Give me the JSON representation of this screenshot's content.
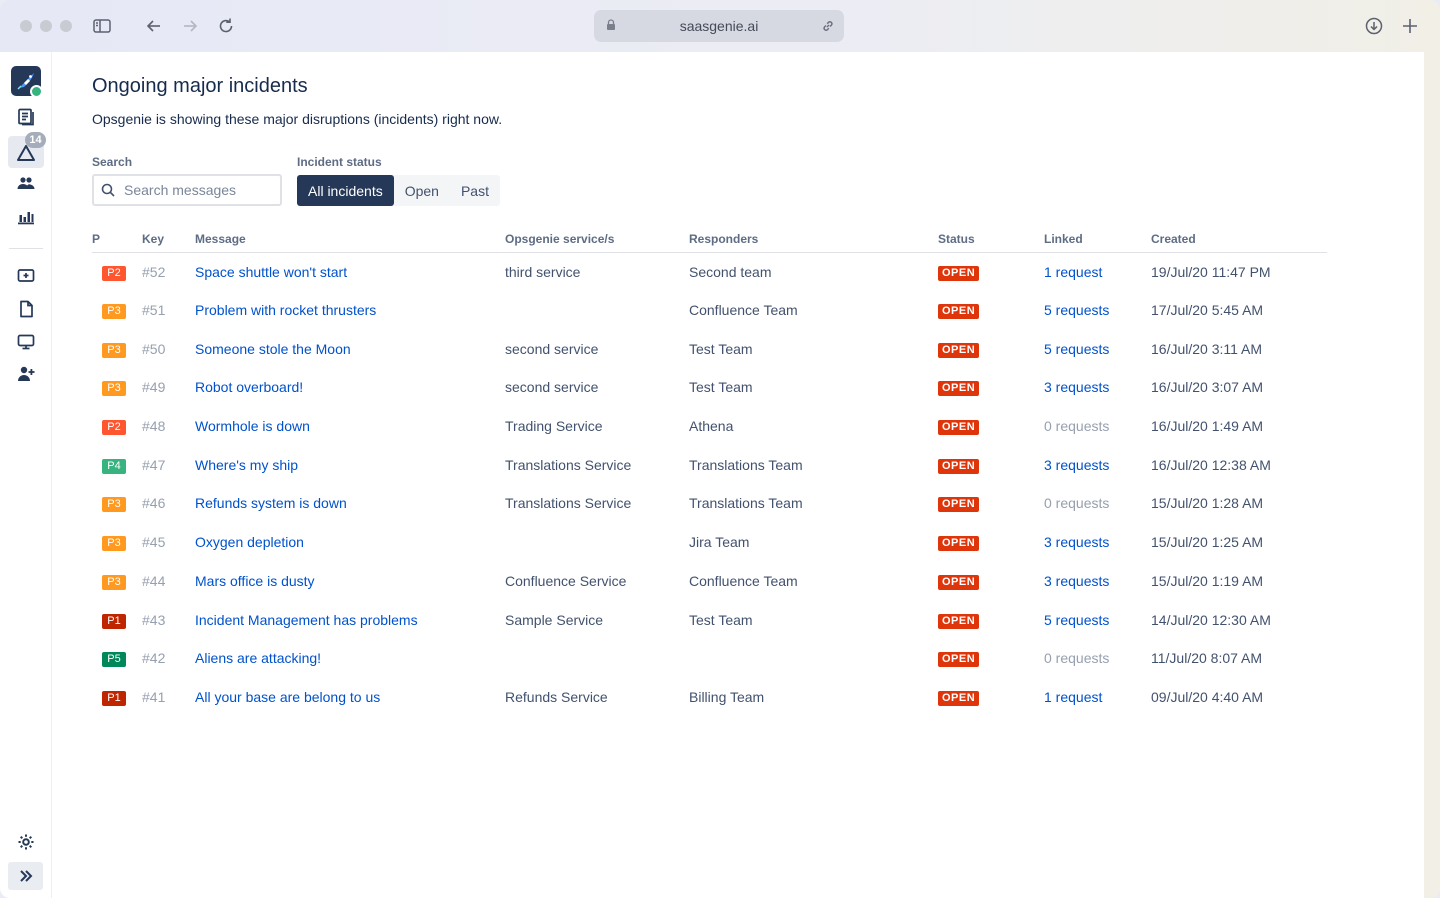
{
  "browser": {
    "url": "saasgenie.ai"
  },
  "sidebar": {
    "alerts_count": "14"
  },
  "page": {
    "title": "Ongoing major incidents",
    "subtitle": "Opsgenie is showing these major disruptions (incidents) right now."
  },
  "search": {
    "label": "Search",
    "placeholder": "Search messages",
    "value": ""
  },
  "status_filter": {
    "label": "Incident status",
    "options": [
      "All incidents",
      "Open",
      "Past"
    ],
    "selected": "All incidents"
  },
  "table": {
    "columns": [
      "P",
      "Key",
      "Message",
      "Opsgenie service/s",
      "Responders",
      "Status",
      "Linked",
      "Created"
    ],
    "rows": [
      {
        "p": "P2",
        "p_color": "#ff5630",
        "key": "#52",
        "message": "Space shuttle won't start",
        "service": "third service",
        "responders": "Second team",
        "status": "OPEN",
        "linked": "1 request",
        "linked_count": 1,
        "created": "19/Jul/20 11:47 PM"
      },
      {
        "p": "P3",
        "p_color": "#ff991f",
        "key": "#51",
        "message": "Problem with rocket thrusters",
        "service": "",
        "responders": "Confluence Team",
        "status": "OPEN",
        "linked": "5 requests",
        "linked_count": 5,
        "created": "17/Jul/20 5:45 AM"
      },
      {
        "p": "P3",
        "p_color": "#ff991f",
        "key": "#50",
        "message": "Someone stole the Moon",
        "service": "second service",
        "responders": "Test Team",
        "status": "OPEN",
        "linked": "5 requests",
        "linked_count": 5,
        "created": "16/Jul/20 3:11 AM"
      },
      {
        "p": "P3",
        "p_color": "#ff991f",
        "key": "#49",
        "message": "Robot overboard!",
        "service": "second service",
        "responders": "Test Team",
        "status": "OPEN",
        "linked": "3 requests",
        "linked_count": 3,
        "created": "16/Jul/20 3:07 AM"
      },
      {
        "p": "P2",
        "p_color": "#ff5630",
        "key": "#48",
        "message": "Wormhole is down",
        "service": "Trading Service",
        "responders": "Athena",
        "status": "OPEN",
        "linked": "0 requests",
        "linked_count": 0,
        "created": "16/Jul/20 1:49 AM"
      },
      {
        "p": "P4",
        "p_color": "#36b37e",
        "key": "#47",
        "message": "Where's my ship",
        "service": "Translations Service",
        "responders": "Translations Team",
        "status": "OPEN",
        "linked": "3 requests",
        "linked_count": 3,
        "created": "16/Jul/20 12:38 AM"
      },
      {
        "p": "P3",
        "p_color": "#ff991f",
        "key": "#46",
        "message": "Refunds system is down",
        "service": "Translations Service",
        "responders": "Translations Team",
        "status": "OPEN",
        "linked": "0 requests",
        "linked_count": 0,
        "created": "15/Jul/20 1:28 AM"
      },
      {
        "p": "P3",
        "p_color": "#ff991f",
        "key": "#45",
        "message": "Oxygen depletion",
        "service": "",
        "responders": "Jira Team",
        "status": "OPEN",
        "linked": "3 requests",
        "linked_count": 3,
        "created": "15/Jul/20 1:25 AM"
      },
      {
        "p": "P3",
        "p_color": "#ff991f",
        "key": "#44",
        "message": "Mars office is dusty",
        "service": "Confluence Service",
        "responders": "Confluence Team",
        "status": "OPEN",
        "linked": "3 requests",
        "linked_count": 3,
        "created": "15/Jul/20 1:19 AM"
      },
      {
        "p": "P1",
        "p_color": "#bf2600",
        "key": "#43",
        "message": "Incident Management has problems",
        "service": "Sample Service",
        "responders": "Test Team",
        "status": "OPEN",
        "linked": "5 requests",
        "linked_count": 5,
        "created": "14/Jul/20 12:30 AM"
      },
      {
        "p": "P5",
        "p_color": "#00875a",
        "key": "#42",
        "message": "Aliens are attacking!",
        "service": "",
        "responders": "",
        "status": "OPEN",
        "linked": "0 requests",
        "linked_count": 0,
        "created": "11/Jul/20 8:07 AM"
      },
      {
        "p": "P1",
        "p_color": "#bf2600",
        "key": "#41",
        "message": "All your base are belong to us",
        "service": "Refunds Service",
        "responders": "Billing Team",
        "status": "OPEN",
        "linked": "1 request",
        "linked_count": 1,
        "created": "09/Jul/20 4:40 AM"
      }
    ]
  },
  "colors": {
    "accent": "#253858",
    "link": "#0052cc",
    "status_open": "#de350b"
  }
}
